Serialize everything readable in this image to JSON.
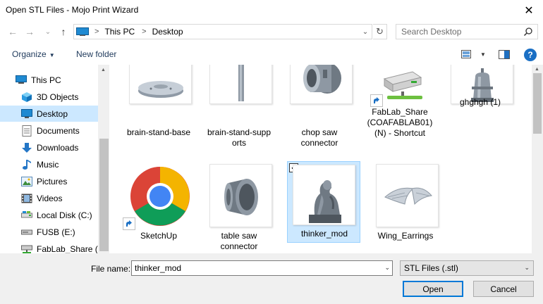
{
  "window": {
    "title": "Open STL Files - Mojo Print Wizard",
    "close_glyph": "✕"
  },
  "navigation": {
    "back_glyph": "←",
    "forward_glyph": "→",
    "recent_glyph": "⌄",
    "up_glyph": "↑",
    "breadcrumbs": [
      "This PC",
      "Desktop"
    ],
    "refresh_glyph": "↻",
    "search_placeholder": "Search Desktop"
  },
  "toolbar": {
    "organize_label": "Organize",
    "new_folder_label": "New folder",
    "help_label": "?"
  },
  "sidebar": {
    "items": [
      {
        "label": "This PC",
        "icon": "computer-icon"
      },
      {
        "label": "3D Objects",
        "icon": "cube-icon"
      },
      {
        "label": "Desktop",
        "icon": "desktop-icon",
        "selected": true
      },
      {
        "label": "Documents",
        "icon": "documents-icon"
      },
      {
        "label": "Downloads",
        "icon": "download-arrow-icon"
      },
      {
        "label": "Music",
        "icon": "music-note-icon"
      },
      {
        "label": "Pictures",
        "icon": "pictures-icon"
      },
      {
        "label": "Videos",
        "icon": "film-icon"
      },
      {
        "label": "Local Disk (C:)",
        "icon": "drive-icon"
      },
      {
        "label": "FUSB (E:)",
        "icon": "usb-drive-icon"
      },
      {
        "label": "FabLab_Share (\\\\",
        "icon": "network-drive-icon"
      }
    ]
  },
  "files": {
    "row1": [
      {
        "name": "brain-stand-base",
        "icon": "stl-disc-thumbnail"
      },
      {
        "name": "brain-stand-supp orts",
        "line1": "brain-stand-supp",
        "line2": "orts",
        "icon": "stl-rod-thumbnail"
      },
      {
        "name": "chop saw connector",
        "line1": "chop saw",
        "line2": "connector",
        "icon": "stl-connector-thumbnail"
      },
      {
        "name": "FabLab_Share (COAFABLAB01) (N) - Shortcut",
        "line1": "FabLab_Share",
        "line2": "(COAFABLAB01)",
        "line3": "(N) - Shortcut",
        "icon": "network-drive-shortcut-icon"
      },
      {
        "name": "ghghgh (1)",
        "icon": "stl-bell-thumbnail"
      }
    ],
    "row2": [
      {
        "name": "SketchUp",
        "icon": "chrome-shortcut-icon"
      },
      {
        "name": "table saw connector",
        "line1": "table saw",
        "line2": "connector",
        "icon": "stl-funnel-thumbnail"
      },
      {
        "name": "thinker_mod",
        "icon": "stl-thinker-thumbnail",
        "selected": true,
        "checked": "✓"
      },
      {
        "name": "Wing_Earrings",
        "icon": "stl-wing-thumbnail"
      }
    ]
  },
  "bottom": {
    "file_name_label": "File name:",
    "file_name_value": "thinker_mod",
    "file_type": "STL Files (.stl)",
    "open_label": "Open",
    "cancel_label": "Cancel"
  },
  "colors": {
    "selection": "#cce8ff",
    "accent": "#0078d7",
    "link": "#1e395b"
  }
}
